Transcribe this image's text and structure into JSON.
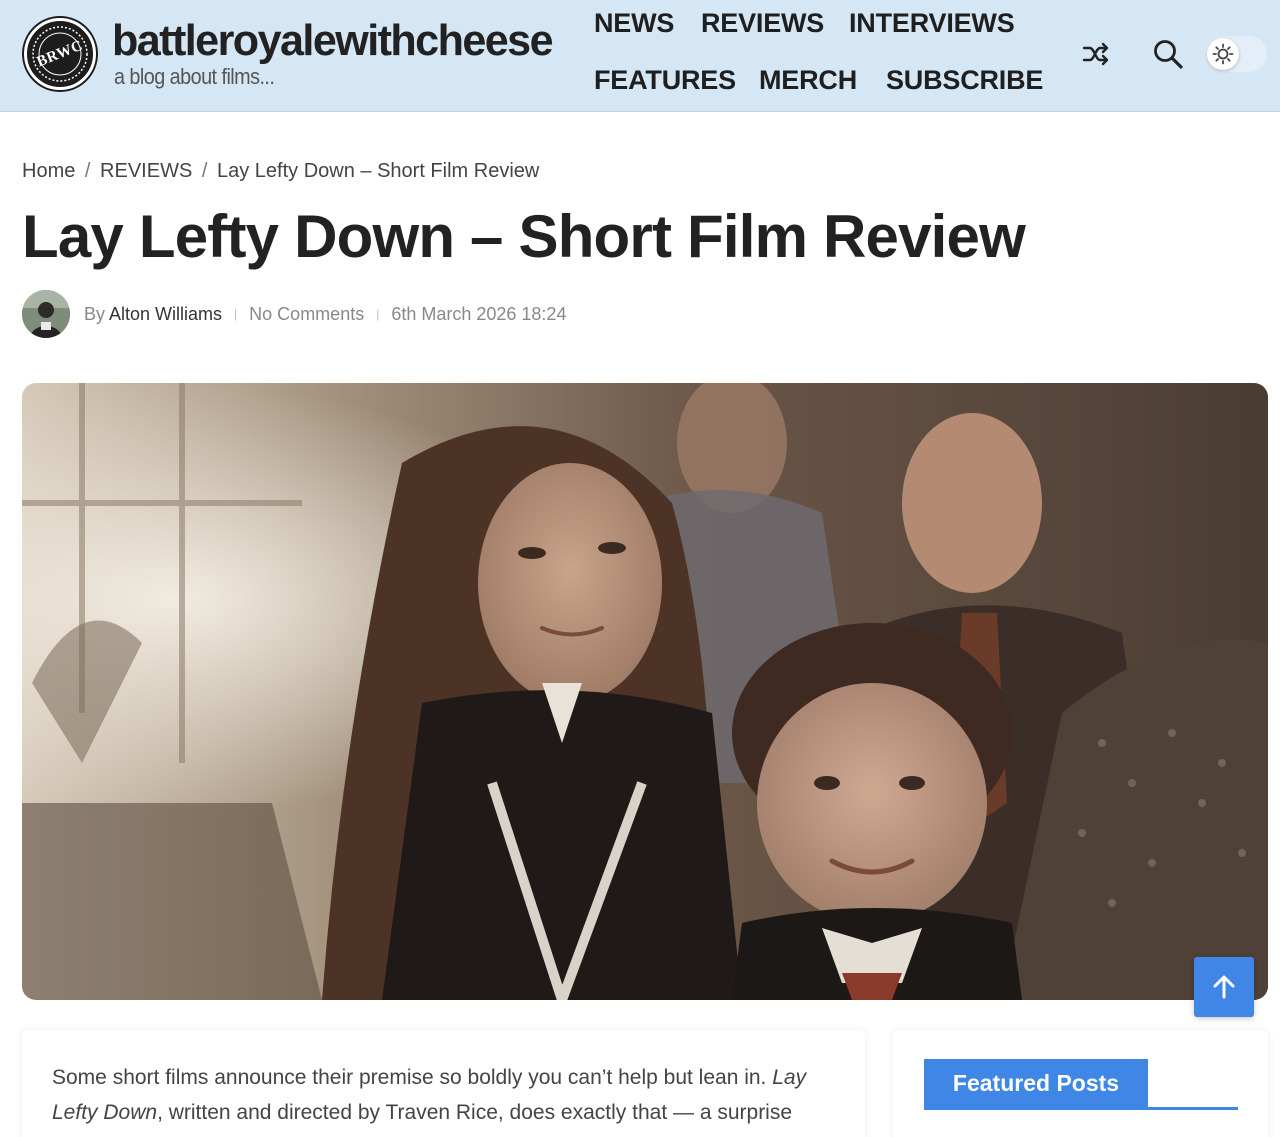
{
  "header": {
    "logo_text": "BRWC",
    "site_title": "battleroyalewithcheese",
    "tagline": "a blog about films...",
    "nav": [
      "NEWS",
      "REVIEWS",
      "INTERVIEWS",
      "FEATURES",
      "MERCH",
      "SUBSCRIBE"
    ],
    "icons": [
      "shuffle-icon",
      "search-icon",
      "sun-icon"
    ]
  },
  "breadcrumb": {
    "home": "Home",
    "category": "REVIEWS",
    "current": "Lay Lefty Down – Short Film Review",
    "separator": "/"
  },
  "post": {
    "title": "Lay Lefty Down – Short Film Review",
    "by": "By",
    "author": "Alton Williams",
    "comments": "No Comments",
    "date": "6th March 2026 18:24"
  },
  "article": {
    "intro_before": "Some short films announce their premise so boldly you can’t help but lean in.",
    "intro_italic_1": "Lay",
    "intro_italic_2": "Lefty Down",
    "intro_after": ", written and directed by Traven Rice, does exactly that — a surprise"
  },
  "sidebar": {
    "widget_title": "Featured Posts"
  },
  "colors": {
    "header_bg": "#d5e6f5",
    "accent": "#3f86e6",
    "text": "#222222"
  }
}
